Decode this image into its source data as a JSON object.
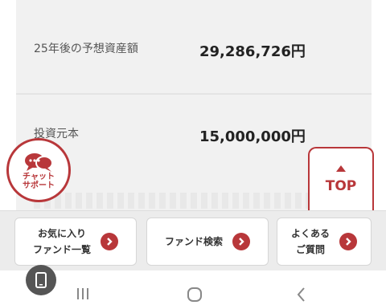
{
  "summary": {
    "rows": [
      {
        "label": "25年後の予想資産額",
        "value": "29,286,726円"
      },
      {
        "label": "投資元本",
        "value": "15,000,000円"
      }
    ]
  },
  "chat": {
    "label_line1": "チャット",
    "label_line2": "サポート",
    "icon": "chat-bubbles-icon"
  },
  "top_button": {
    "label": "TOP",
    "icon": "triangle-up-icon"
  },
  "quick_links": [
    {
      "label": "お気に入り\nファンド一覧",
      "icon": "chevron-right-icon"
    },
    {
      "label": "ファンド検索",
      "icon": "chevron-right-icon"
    },
    {
      "label": "よくある\nご質問",
      "icon": "chevron-right-icon"
    }
  ],
  "nav_icons": [
    "phone-icon",
    "recent-apps-icon",
    "home-icon",
    "back-icon"
  ],
  "colors": {
    "accent": "#b8373a",
    "card": "#f1f1f1",
    "bar": "#ececec"
  }
}
